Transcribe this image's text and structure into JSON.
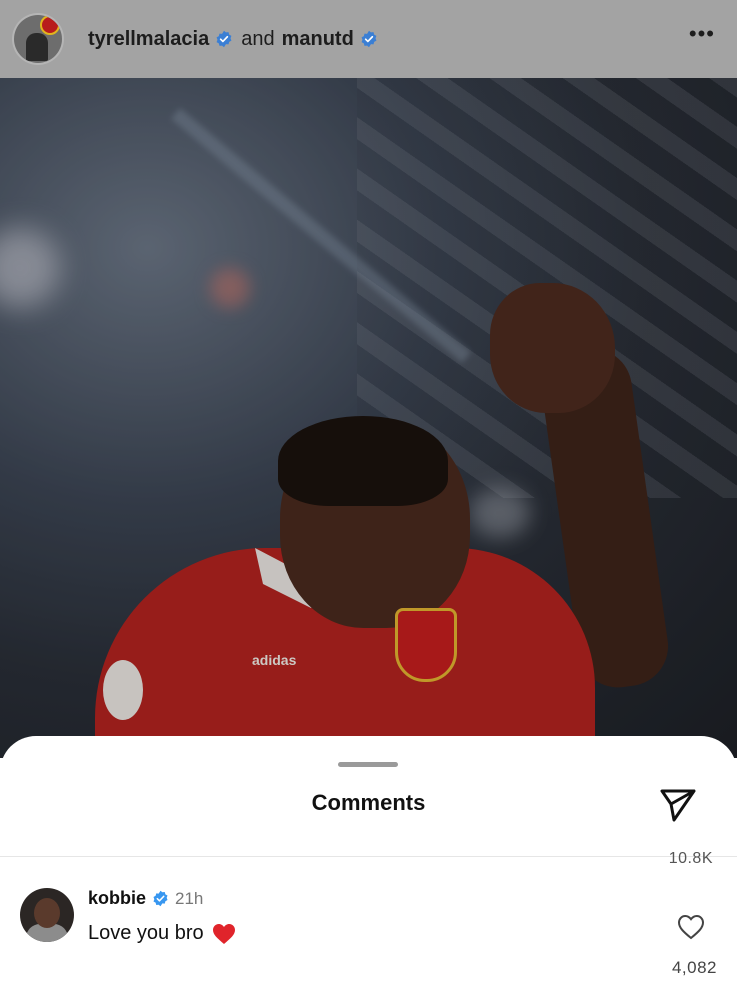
{
  "header": {
    "user1": "tyrellmalacia",
    "connector": "and",
    "user2": "manutd",
    "more_icon": "ellipsis-icon"
  },
  "photo": {
    "kit_brand": "adidas"
  },
  "comments_sheet": {
    "title": "Comments",
    "share_icon": "send-icon",
    "previous_like_count": "10.8K",
    "comments": [
      {
        "username": "kobbie",
        "verified": true,
        "time": "21h",
        "text": "Love you bro",
        "emoji": "red-heart",
        "like_count": "4,082"
      }
    ]
  },
  "colors": {
    "verified_blue": "#3897f0",
    "heart_red": "#e0242b",
    "shirt_red": "#b4231f"
  }
}
